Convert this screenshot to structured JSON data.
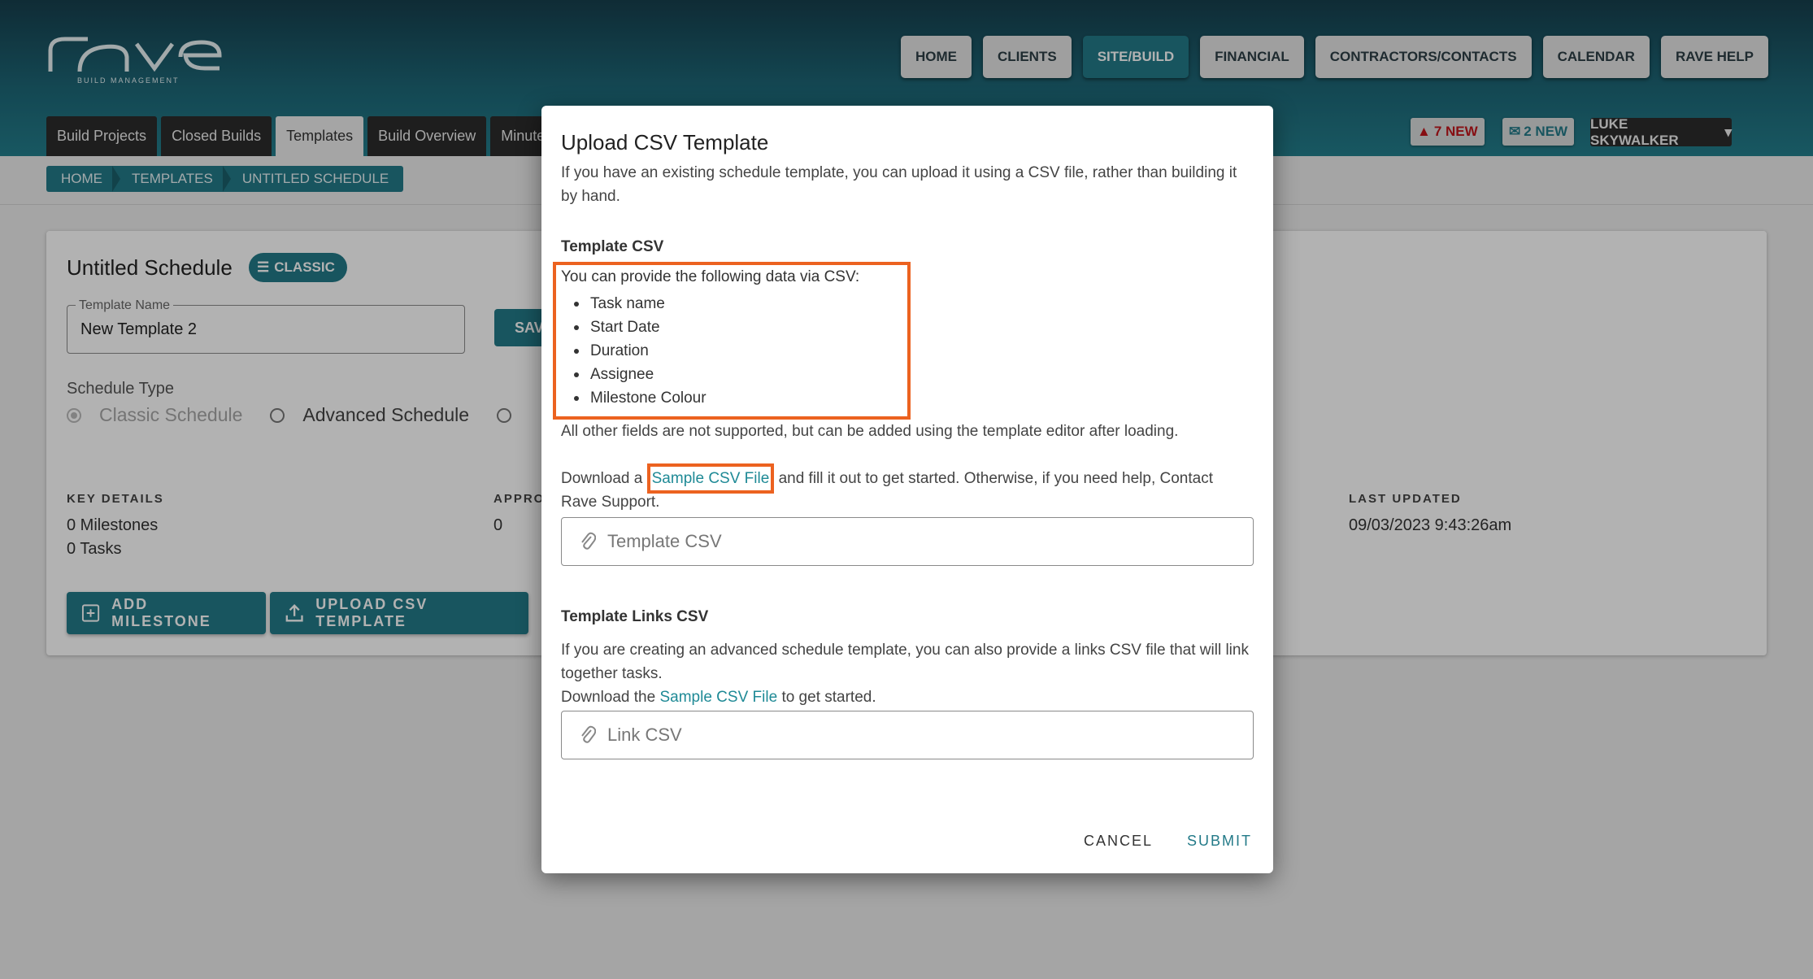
{
  "brand": {
    "logo_word": "rave",
    "tagline": "BUILD MANAGEMENT"
  },
  "topnav": [
    "HOME",
    "CLIENTS",
    "SITE/BUILD",
    "FINANCIAL",
    "CONTRACTORS/CONTACTS",
    "CALENDAR",
    "RAVE HELP"
  ],
  "topnav_active": "SITE/BUILD",
  "tabs": [
    "Build Projects",
    "Closed Builds",
    "Templates",
    "Build Overview",
    "Minutes"
  ],
  "tabs_active": "Templates",
  "notifications": {
    "alerts": "7 NEW",
    "messages": "2 NEW"
  },
  "user": {
    "name": "LUKE SKYWALKER"
  },
  "breadcrumb": [
    "HOME",
    "TEMPLATES",
    "UNTITLED SCHEDULE"
  ],
  "card": {
    "title": "Untitled Schedule",
    "type_badge": "CLASSIC",
    "template_name_label": "Template Name",
    "template_name_value": "New Template 2",
    "save_label": "SAVE",
    "schedule_type_label": "Schedule Type",
    "schedule_options": [
      "Classic Schedule",
      "Advanced Schedule"
    ],
    "key_details_label": "KEY DETAILS",
    "milestones": "0 Milestones",
    "tasks": "0 Tasks",
    "approvals_label": "APPRO",
    "approvals_value": "0",
    "last_updated_label": "LAST UPDATED",
    "last_updated_value": "09/03/2023 9:43:26am",
    "add_milestone_label": "ADD MILESTONE",
    "upload_csv_label": "UPLOAD CSV TEMPLATE"
  },
  "modal": {
    "title": "Upload CSV Template",
    "intro": "If you have an existing schedule template, you can upload it using a CSV file, rather than building it by hand.",
    "template_section": "Template CSV",
    "fields_lead": "You can provide the following data via CSV:",
    "fields": [
      "Task name",
      "Start Date",
      "Duration",
      "Assignee",
      "Milestone Colour"
    ],
    "unsupported_note": "All other fields are not supported, but can be added using the template editor after loading.",
    "download_prefix": "Download a",
    "sample_link": "Sample CSV File",
    "download_suffix": "and fill it out to get started. Otherwise, if you need help, Contact Rave Support.",
    "template_placeholder": "Template CSV",
    "links_section": "Template Links CSV",
    "links_intro": "If you are creating an advanced schedule template, you can also provide a links CSV file that will link together tasks.",
    "links_download_prefix": "Download the",
    "links_sample_link": "Sample CSV File",
    "links_download_suffix": "to get started.",
    "link_placeholder": "Link CSV",
    "cancel_label": "CANCEL",
    "submit_label": "SUBMIT"
  },
  "colors": {
    "accent": "#237a88",
    "highlight": "#ec6220",
    "header_dark": "#163f4d"
  }
}
